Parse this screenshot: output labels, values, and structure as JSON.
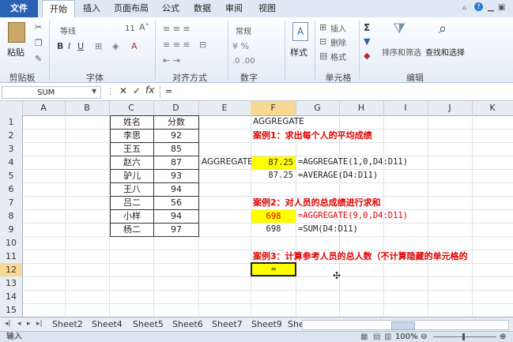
{
  "tabs": [
    "文件",
    "开始",
    "插入",
    "页面布局",
    "公式",
    "数据",
    "审阅",
    "视图"
  ],
  "ribbon": {
    "paste_label": "粘贴",
    "clipboard_label": "剪贴板",
    "font_name": "等线",
    "font_size": "11",
    "font_label": "字体",
    "align_label": "对齐方式",
    "number_format": "常规",
    "number_label": "数字",
    "styles_label": "样式",
    "insert_label": "插入",
    "delete_label": "删除",
    "format_label": "格式",
    "cells_label": "单元格",
    "sort_filter_label": "排序和筛选",
    "find_select_label": "查找和选择",
    "editing_label": "编辑"
  },
  "formula_bar": {
    "name_box": "SUM",
    "content": "="
  },
  "columns": [
    "A",
    "B",
    "C",
    "D",
    "E",
    "F",
    "G",
    "H",
    "I",
    "J",
    "K"
  ],
  "rows": [
    "1",
    "2",
    "3",
    "4",
    "5",
    "6",
    "7",
    "8",
    "9",
    "10",
    "11",
    "12",
    "13",
    "14",
    "15"
  ],
  "table": {
    "header": [
      "姓名",
      "分数"
    ],
    "rows": [
      [
        "李思",
        "92"
      ],
      [
        "王五",
        "85"
      ],
      [
        "赵六",
        "87"
      ],
      [
        "驴儿",
        "93"
      ],
      [
        "王八",
        "94"
      ],
      [
        "吕二",
        "56"
      ],
      [
        "小样",
        "94"
      ],
      [
        "杨二",
        "97"
      ]
    ]
  },
  "cells": {
    "F1": "AGGREGATE",
    "F2": "案例1：求出每个人的平均成绩",
    "E4": "AGGREGATE",
    "F4": "87.25",
    "G4": "=AGGREGATE(1,0,D4:D11)",
    "F5": "87.25",
    "G5": "=AVERAGE(D4:D11)",
    "F7": "案例2：对人员的总成绩进行求和",
    "F8": "698",
    "G8": "=AGGREGATE(9,0,D4:D11)",
    "F9": "698",
    "G9": "=SUM(D4:D11)",
    "F11": "案例3：计算参考人员的总人数（不计算隐藏的单元格的",
    "F12": "="
  },
  "sheets": [
    "Sheet2",
    "Sheet4",
    "Sheet5",
    "Sheet6",
    "Sheet7",
    "Sheet9",
    "She"
  ],
  "status": {
    "mode": "输入",
    "zoom": "100%"
  },
  "colors": {
    "highlight": "#ffff00",
    "red_text": "#e00000",
    "file_tab": "#2a62b3"
  }
}
